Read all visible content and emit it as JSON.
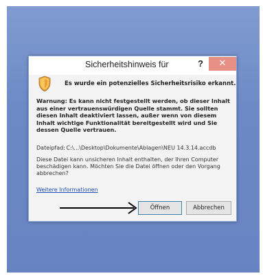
{
  "dialog": {
    "title": "Sicherheitshinweis für",
    "help_label": "?",
    "close_label": "✕",
    "heading": "Es wurde ein potenzielles Sicherheitsrisiko erkannt.",
    "warning": "Warnung: Es kann nicht festgestellt werden, ob dieser Inhalt aus einer vertrauenswürdigen Quelle stammt. Sie sollten diesen Inhalt deaktiviert lassen, außer wenn von diesem Inhalt wichtige Funktionalität bereitgestellt wird und Sie dessen Quelle vertrauen.",
    "path_label": "Dateipfad:",
    "path_value": "C:\\...\\Desktop\\Dokumente\\Ablagen\\NEU 14.3.14.accdb",
    "info": "Diese Datei kann unsicheren Inhalt enthalten, der Ihren Computer beschädigen kann. Möchten Sie die Datei öffnen oder den Vorgang abbrechen?",
    "more_info_link": "Weitere Informationen",
    "open_button": "Öffnen",
    "cancel_button": "Abbrechen"
  },
  "icons": {
    "security": "shield-warning-icon",
    "annotation": "arrow-right-icon"
  },
  "colors": {
    "desktop": "#6c89c5",
    "close": "#e68f85",
    "link": "#1f4fb8"
  }
}
